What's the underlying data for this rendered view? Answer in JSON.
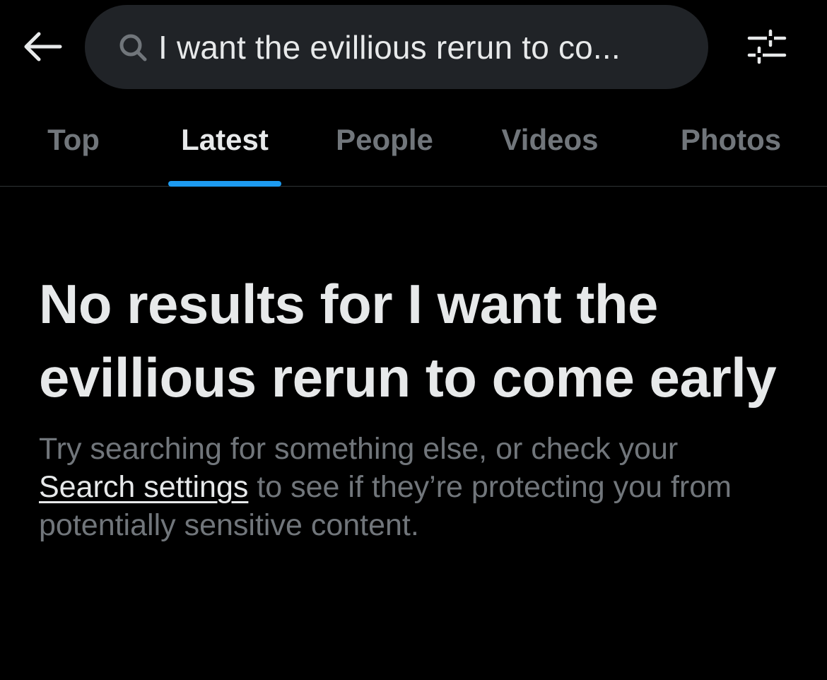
{
  "header": {
    "back_icon": "arrow-left-icon",
    "search": {
      "icon": "search-icon",
      "query_display": "I want the evillious rerun to co..."
    },
    "filter_icon": "sliders-icon"
  },
  "tabs": [
    {
      "label": "Top",
      "active": false
    },
    {
      "label": "Latest",
      "active": true
    },
    {
      "label": "People",
      "active": false
    },
    {
      "label": "Videos",
      "active": false
    },
    {
      "label": "Photos",
      "active": false
    }
  ],
  "empty_state": {
    "title": "No results for I want the evillious rerun to come early",
    "body_before_link": "Try searching for something else, or check your ",
    "link_label": "Search settings",
    "body_after_link": " to see if they’re protecting you from potentially sensitive content."
  },
  "colors": {
    "background": "#000000",
    "search_bg": "#202327",
    "primary_text": "#e7e9ea",
    "secondary_text": "#71767b",
    "accent": "#1d9bf0",
    "divider": "#2f3336"
  }
}
